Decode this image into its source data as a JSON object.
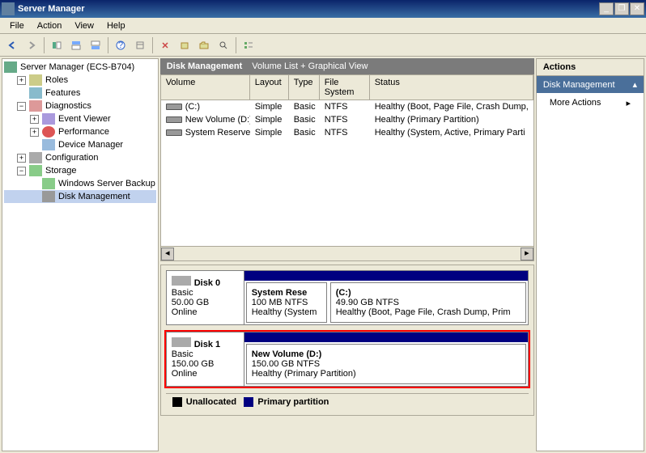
{
  "title": "Server Manager",
  "window_buttons": {
    "min": "_",
    "max": "❐",
    "close": "✕"
  },
  "menu": [
    "File",
    "Action",
    "View",
    "Help"
  ],
  "tree": {
    "root": "Server Manager (ECS-B704)",
    "roles": "Roles",
    "features": "Features",
    "diagnostics": "Diagnostics",
    "event_viewer": "Event Viewer",
    "performance": "Performance",
    "device_manager": "Device Manager",
    "configuration": "Configuration",
    "storage": "Storage",
    "wsb": "Windows Server Backup",
    "disk_mgmt": "Disk Management"
  },
  "center": {
    "title": "Disk Management",
    "subtitle": "Volume List + Graphical View"
  },
  "vol_headers": {
    "volume": "Volume",
    "layout": "Layout",
    "type": "Type",
    "fs": "File System",
    "status": "Status"
  },
  "volumes": [
    {
      "name": "(C:)",
      "layout": "Simple",
      "type": "Basic",
      "fs": "NTFS",
      "status": "Healthy (Boot, Page File, Crash Dump,"
    },
    {
      "name": "New Volume (D:)",
      "layout": "Simple",
      "type": "Basic",
      "fs": "NTFS",
      "status": "Healthy (Primary Partition)"
    },
    {
      "name": "System Reserved",
      "layout": "Simple",
      "type": "Basic",
      "fs": "NTFS",
      "status": "Healthy (System, Active, Primary Parti"
    }
  ],
  "disks": [
    {
      "name": "Disk 0",
      "type": "Basic",
      "size": "50.00 GB",
      "state": "Online",
      "parts": [
        {
          "title": "System Rese",
          "line2": "100 MB NTFS",
          "line3": "Healthy (System"
        },
        {
          "title": "(C:)",
          "line2": "49.90 GB NTFS",
          "line3": "Healthy (Boot, Page File, Crash Dump, Prim"
        }
      ]
    },
    {
      "name": "Disk 1",
      "type": "Basic",
      "size": "150.00 GB",
      "state": "Online",
      "parts": [
        {
          "title": "New Volume  (D:)",
          "line2": "150.00 GB NTFS",
          "line3": "Healthy (Primary Partition)"
        }
      ]
    }
  ],
  "legend": {
    "unalloc": "Unallocated",
    "primary": "Primary partition"
  },
  "actions": {
    "header": "Actions",
    "section": "Disk Management",
    "more": "More Actions"
  }
}
